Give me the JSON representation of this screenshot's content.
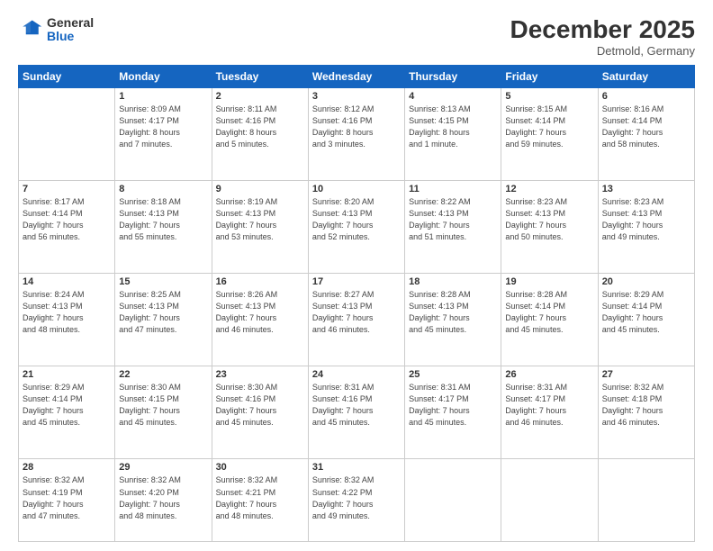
{
  "header": {
    "logo_line1": "General",
    "logo_line2": "Blue",
    "month": "December 2025",
    "location": "Detmold, Germany"
  },
  "weekdays": [
    "Sunday",
    "Monday",
    "Tuesday",
    "Wednesday",
    "Thursday",
    "Friday",
    "Saturday"
  ],
  "weeks": [
    [
      {
        "day": "",
        "info": ""
      },
      {
        "day": "1",
        "info": "Sunrise: 8:09 AM\nSunset: 4:17 PM\nDaylight: 8 hours\nand 7 minutes."
      },
      {
        "day": "2",
        "info": "Sunrise: 8:11 AM\nSunset: 4:16 PM\nDaylight: 8 hours\nand 5 minutes."
      },
      {
        "day": "3",
        "info": "Sunrise: 8:12 AM\nSunset: 4:16 PM\nDaylight: 8 hours\nand 3 minutes."
      },
      {
        "day": "4",
        "info": "Sunrise: 8:13 AM\nSunset: 4:15 PM\nDaylight: 8 hours\nand 1 minute."
      },
      {
        "day": "5",
        "info": "Sunrise: 8:15 AM\nSunset: 4:14 PM\nDaylight: 7 hours\nand 59 minutes."
      },
      {
        "day": "6",
        "info": "Sunrise: 8:16 AM\nSunset: 4:14 PM\nDaylight: 7 hours\nand 58 minutes."
      }
    ],
    [
      {
        "day": "7",
        "info": "Sunrise: 8:17 AM\nSunset: 4:14 PM\nDaylight: 7 hours\nand 56 minutes."
      },
      {
        "day": "8",
        "info": "Sunrise: 8:18 AM\nSunset: 4:13 PM\nDaylight: 7 hours\nand 55 minutes."
      },
      {
        "day": "9",
        "info": "Sunrise: 8:19 AM\nSunset: 4:13 PM\nDaylight: 7 hours\nand 53 minutes."
      },
      {
        "day": "10",
        "info": "Sunrise: 8:20 AM\nSunset: 4:13 PM\nDaylight: 7 hours\nand 52 minutes."
      },
      {
        "day": "11",
        "info": "Sunrise: 8:22 AM\nSunset: 4:13 PM\nDaylight: 7 hours\nand 51 minutes."
      },
      {
        "day": "12",
        "info": "Sunrise: 8:23 AM\nSunset: 4:13 PM\nDaylight: 7 hours\nand 50 minutes."
      },
      {
        "day": "13",
        "info": "Sunrise: 8:23 AM\nSunset: 4:13 PM\nDaylight: 7 hours\nand 49 minutes."
      }
    ],
    [
      {
        "day": "14",
        "info": "Sunrise: 8:24 AM\nSunset: 4:13 PM\nDaylight: 7 hours\nand 48 minutes."
      },
      {
        "day": "15",
        "info": "Sunrise: 8:25 AM\nSunset: 4:13 PM\nDaylight: 7 hours\nand 47 minutes."
      },
      {
        "day": "16",
        "info": "Sunrise: 8:26 AM\nSunset: 4:13 PM\nDaylight: 7 hours\nand 46 minutes."
      },
      {
        "day": "17",
        "info": "Sunrise: 8:27 AM\nSunset: 4:13 PM\nDaylight: 7 hours\nand 46 minutes."
      },
      {
        "day": "18",
        "info": "Sunrise: 8:28 AM\nSunset: 4:13 PM\nDaylight: 7 hours\nand 45 minutes."
      },
      {
        "day": "19",
        "info": "Sunrise: 8:28 AM\nSunset: 4:14 PM\nDaylight: 7 hours\nand 45 minutes."
      },
      {
        "day": "20",
        "info": "Sunrise: 8:29 AM\nSunset: 4:14 PM\nDaylight: 7 hours\nand 45 minutes."
      }
    ],
    [
      {
        "day": "21",
        "info": "Sunrise: 8:29 AM\nSunset: 4:14 PM\nDaylight: 7 hours\nand 45 minutes."
      },
      {
        "day": "22",
        "info": "Sunrise: 8:30 AM\nSunset: 4:15 PM\nDaylight: 7 hours\nand 45 minutes."
      },
      {
        "day": "23",
        "info": "Sunrise: 8:30 AM\nSunset: 4:16 PM\nDaylight: 7 hours\nand 45 minutes."
      },
      {
        "day": "24",
        "info": "Sunrise: 8:31 AM\nSunset: 4:16 PM\nDaylight: 7 hours\nand 45 minutes."
      },
      {
        "day": "25",
        "info": "Sunrise: 8:31 AM\nSunset: 4:17 PM\nDaylight: 7 hours\nand 45 minutes."
      },
      {
        "day": "26",
        "info": "Sunrise: 8:31 AM\nSunset: 4:17 PM\nDaylight: 7 hours\nand 46 minutes."
      },
      {
        "day": "27",
        "info": "Sunrise: 8:32 AM\nSunset: 4:18 PM\nDaylight: 7 hours\nand 46 minutes."
      }
    ],
    [
      {
        "day": "28",
        "info": "Sunrise: 8:32 AM\nSunset: 4:19 PM\nDaylight: 7 hours\nand 47 minutes."
      },
      {
        "day": "29",
        "info": "Sunrise: 8:32 AM\nSunset: 4:20 PM\nDaylight: 7 hours\nand 48 minutes."
      },
      {
        "day": "30",
        "info": "Sunrise: 8:32 AM\nSunset: 4:21 PM\nDaylight: 7 hours\nand 48 minutes."
      },
      {
        "day": "31",
        "info": "Sunrise: 8:32 AM\nSunset: 4:22 PM\nDaylight: 7 hours\nand 49 minutes."
      },
      {
        "day": "",
        "info": ""
      },
      {
        "day": "",
        "info": ""
      },
      {
        "day": "",
        "info": ""
      }
    ]
  ]
}
